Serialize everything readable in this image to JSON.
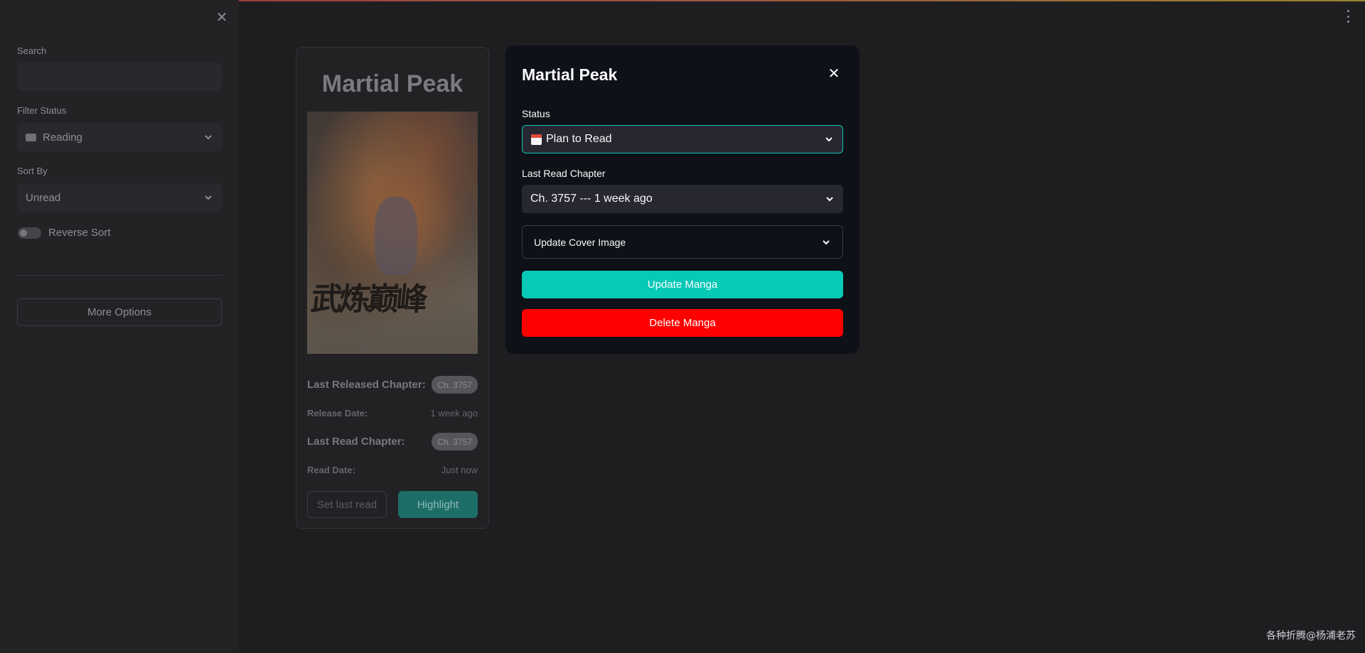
{
  "sidebar": {
    "search_label": "Search",
    "search_value": "",
    "filter_label": "Filter Status",
    "filter_value": "Reading",
    "sort_label": "Sort By",
    "sort_value": "Unread",
    "reverse_label": "Reverse Sort",
    "reverse_on": false,
    "more_options": "More Options"
  },
  "card": {
    "title": "Martial Peak",
    "cover_text": "武炼巅峰",
    "last_released_label": "Last Released Chapter:",
    "last_released_value": "Ch. 3757",
    "release_date_label": "Release Date:",
    "release_date_value": "1 week ago",
    "last_read_label": "Last Read Chapter:",
    "last_read_value": "Ch. 3757",
    "read_date_label": "Read Date:",
    "read_date_value": "Just now",
    "set_last_read": "Set last read",
    "highlight": "Highlight"
  },
  "modal": {
    "title": "Martial Peak",
    "status_label": "Status",
    "status_value": "Plan to Read",
    "last_read_label": "Last Read Chapter",
    "last_read_value": "Ch. 3757 --- 1 week ago",
    "update_cover": "Update Cover Image",
    "update_button": "Update Manga",
    "delete_button": "Delete Manga"
  },
  "watermark": "各种折腾@杨浦老苏",
  "colors": {
    "accent": "#08c8b6",
    "danger": "#ff0000",
    "modal_bg": "#0e1117"
  }
}
